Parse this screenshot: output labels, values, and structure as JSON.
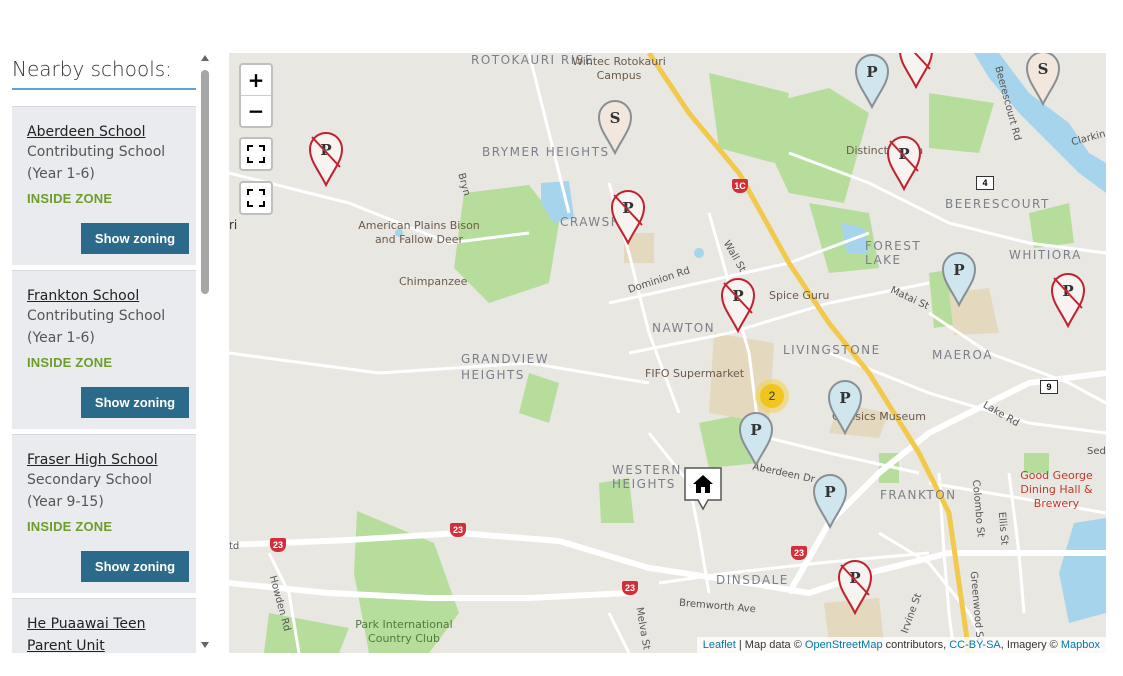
{
  "sidebar": {
    "title": "Nearby schools:",
    "schools": [
      {
        "name": "Aberdeen School",
        "type": "Contributing School (Year 1-6)",
        "zone": "INSIDE ZONE",
        "button": "Show zoning"
      },
      {
        "name": "Frankton School",
        "type": "Contributing School (Year 1-6)",
        "zone": "INSIDE ZONE",
        "button": "Show zoning"
      },
      {
        "name": "Fraser High School",
        "type": "Secondary School (Year 9-15)",
        "zone": "INSIDE ZONE",
        "button": "Show zoning"
      },
      {
        "name": "He Puaawai Teen Parent Unit"
      }
    ]
  },
  "map": {
    "controls": {
      "zoom_in": "+",
      "zoom_out": "−"
    },
    "areas": [
      "ROTOKAURI RISE",
      "BRYMER HEIGHTS",
      "CRAWSH",
      "NAWTON",
      "GRANDVIEW HEIGHTS",
      "LIVINGSTONE",
      "MAEROA",
      "FOREST LAKE",
      "BEERESCOURT",
      "WHITIORA",
      "WESTERN HEIGHTS",
      "FRANKTON",
      "DINSDALE"
    ],
    "pois": [
      "Wintec Rotokauri Campus",
      "American Plains Bison and Fallow Deer",
      "Chimpanzee",
      "Spice Guru",
      "FIFO Supermarket",
      "Classics Museum",
      "Good George Dining Hall & Brewery",
      "Park International Country Club",
      "Distinction Ha",
      "ri"
    ],
    "roads": [
      "Dominion Rd",
      "Wall St",
      "Matai St",
      "Lake Rd",
      "Aberdeen Dr",
      "Colombo St",
      "Ellis St",
      "Bremworth Ave",
      "Howden Rd",
      "Melva St",
      "Irvine St",
      "Greenwood St",
      "Beerescourt Rd",
      "Clarkin",
      "Bryn",
      "Sed",
      "td"
    ],
    "shields": [
      "1C",
      "23",
      "23",
      "23",
      "23"
    ],
    "state_shields": [
      "4",
      "9"
    ],
    "cluster_count": "2",
    "marker_letters": {
      "primary": "P",
      "secondary": "S"
    },
    "attribution": {
      "leaflet": "Leaflet",
      "map_data": "| Map data ©",
      "osm": "OpenStreetMap",
      "contributors": "contributors,",
      "license": "CC-BY-SA",
      "imagery": ", Imagery ©",
      "mapbox": "Mapbox"
    },
    "colors": {
      "marker_in_zone": "#cfe6ef",
      "marker_out_zone": "#d32f3a",
      "secondary_marker": "#f3e6dc",
      "park": "#a9d88f",
      "water": "#9fd0ea",
      "highway": "#f2c94c"
    }
  }
}
